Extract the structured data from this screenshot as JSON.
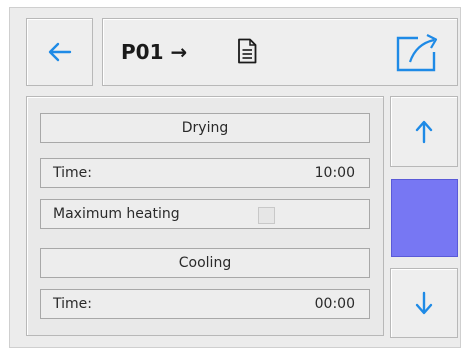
{
  "header": {
    "program_label": "P01 →",
    "back_icon": "arrow-left-icon",
    "document_icon": "document-icon",
    "export_icon": "export-icon"
  },
  "rows": {
    "drying_label": "Drying",
    "drying_time_label": "Time:",
    "drying_time_value": "10:00",
    "max_heating_label": "Maximum heating",
    "max_heating_checked": false,
    "cooling_label": "Cooling",
    "cooling_time_label": "Time:",
    "cooling_time_value": "00:00"
  },
  "scroll": {
    "up_icon": "arrow-up-icon",
    "down_icon": "arrow-down-icon"
  },
  "colors": {
    "accent": "#1e8ae6",
    "thumb": "#7777f3",
    "background": "#ececec"
  }
}
